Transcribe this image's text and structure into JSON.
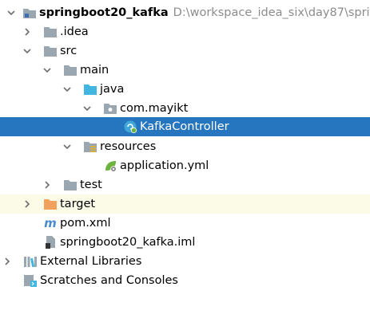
{
  "project": {
    "name": "springboot20_kafka",
    "path": "D:\\workspace_idea_six\\day87\\sprin"
  },
  "nodes": {
    "idea": ".idea",
    "src": "src",
    "main": "main",
    "java": "java",
    "package": "com.mayikt",
    "controller": "KafkaController",
    "resources": "resources",
    "app_yml": "application.yml",
    "test": "test",
    "target": "target",
    "pom": "pom.xml",
    "iml": "springboot20_kafka.iml",
    "ext_libs": "External Libraries",
    "scratches": "Scratches and Consoles"
  },
  "colors": {
    "selection": "#2675bf",
    "folder_gray": "#9aa7b0",
    "source_folder": "#40b6e0",
    "excluded_folder": "#f0a15c",
    "target_row_bg": "#fbfbe8",
    "spring_green": "#6db33f",
    "path_gray": "#8c8c8c"
  },
  "icons": [
    "chevron-down-icon",
    "chevron-right-icon",
    "folder-icon",
    "source-folder-icon",
    "package-icon",
    "spring-class-icon",
    "resources-folder-icon",
    "spring-yml-icon",
    "maven-icon",
    "iml-file-icon",
    "libraries-icon",
    "scratches-icon"
  ]
}
